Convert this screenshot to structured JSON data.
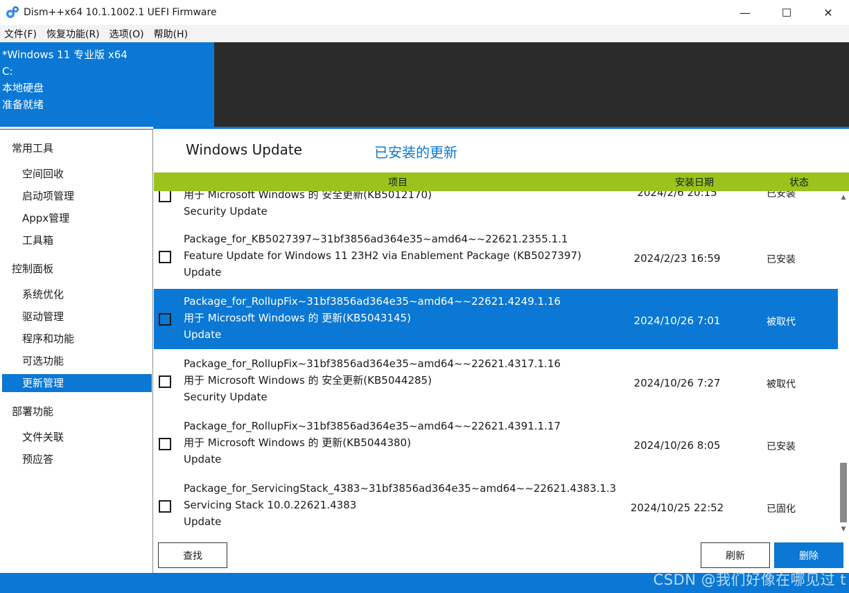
{
  "window": {
    "title": "Dism++x64 10.1.1002.1 UEFI Firmware",
    "controls": {
      "minimize": "—",
      "maximize": "☐",
      "close": "✕"
    }
  },
  "menu": [
    "文件(F)",
    "恢复功能(R)",
    "选项(O)",
    "帮助(H)"
  ],
  "image_info": {
    "name": "*Windows 11 专业版 x64",
    "drive": "C:",
    "disk": "本地硬盘",
    "status": "准备就绪"
  },
  "sidebar": {
    "groups": [
      {
        "label": "常用工具",
        "items": [
          "空间回收",
          "启动项管理",
          "Appx管理",
          "工具箱"
        ]
      },
      {
        "label": "控制面板",
        "items": [
          "系统优化",
          "驱动管理",
          "程序和功能",
          "可选功能",
          "更新管理"
        ]
      },
      {
        "label": "部署功能",
        "items": [
          "文件关联",
          "预应答"
        ]
      }
    ],
    "active": "更新管理"
  },
  "main": {
    "title": "Windows Update",
    "subtitle": "已安装的更新",
    "columns": {
      "item": "项目",
      "date": "安装日期",
      "status": "状态"
    }
  },
  "rows": [
    {
      "lines": [
        "用于 Microsoft Windows 的 安全更新(KB5012170)",
        "Security Update"
      ],
      "date": "2024/2/6 20:15",
      "status": "已安装",
      "selected": false
    },
    {
      "lines": [
        "Package_for_KB5027397~31bf3856ad364e35~amd64~~22621.2355.1.1",
        "Feature Update for Windows 11 23H2 via Enablement Package (KB5027397)",
        "Update"
      ],
      "date": "2024/2/23 16:59",
      "status": "已安装",
      "selected": false
    },
    {
      "lines": [
        "Package_for_RollupFix~31bf3856ad364e35~amd64~~22621.4249.1.16",
        "用于 Microsoft Windows 的 更新(KB5043145)",
        "Update"
      ],
      "date": "2024/10/26 7:01",
      "status": "被取代",
      "selected": true
    },
    {
      "lines": [
        "Package_for_RollupFix~31bf3856ad364e35~amd64~~22621.4317.1.16",
        "用于 Microsoft Windows 的 安全更新(KB5044285)",
        "Security Update"
      ],
      "date": "2024/10/26 7:27",
      "status": "被取代",
      "selected": false
    },
    {
      "lines": [
        "Package_for_RollupFix~31bf3856ad364e35~amd64~~22621.4391.1.17",
        "用于 Microsoft Windows 的 更新(KB5044380)",
        "Update"
      ],
      "date": "2024/10/26 8:05",
      "status": "已安装",
      "selected": false
    },
    {
      "lines": [
        "Package_for_ServicingStack_4383~31bf3856ad364e35~amd64~~22621.4383.1.3",
        "Servicing Stack 10.0.22621.4383",
        "Update"
      ],
      "date": "2024/10/25 22:52",
      "status": "已固化",
      "selected": false
    }
  ],
  "buttons": {
    "find": "查找",
    "refresh": "刷新",
    "delete": "删除"
  },
  "watermark": "CSDN @我们好像在哪见过 t",
  "colors": {
    "accent": "#0a78d4",
    "header_green": "#9bc31c",
    "dark_panel": "#2b2b2b"
  }
}
